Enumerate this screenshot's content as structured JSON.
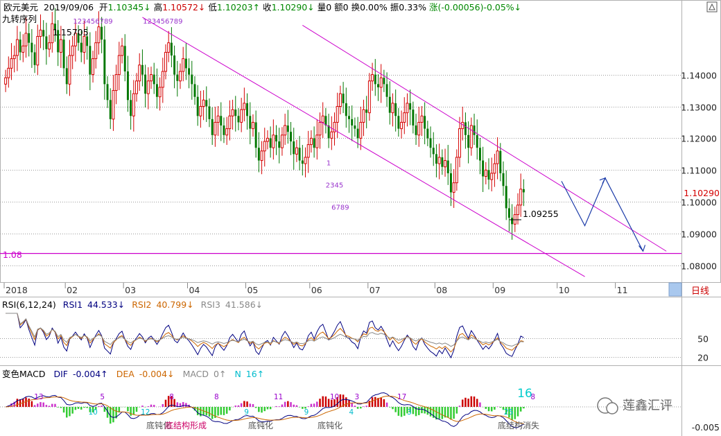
{
  "header": {
    "symbol": "欧元美元",
    "date": "2019/09/06",
    "open_label": "开",
    "open_value": "1.10345↓",
    "high_label": "高",
    "high_value": "1.10572↓",
    "low_label": "低",
    "low_value": "1.10203↑",
    "close_label": "收",
    "close_value": "1.10290↓",
    "volume": "量0",
    "amount": "额0",
    "turnover": "换0.00%",
    "amplitude": "振0.33%",
    "change": "涨(-0.00056)-0.05%↓",
    "indicator_name": "九转序列"
  },
  "colors": {
    "up": "#d40000",
    "down": "#007700",
    "channel": "#cc00cc",
    "grid": "#9a9a9a",
    "axis_text": "#222222",
    "rsi1": "#000080",
    "rsi2": "#cc6600",
    "rsi3": "#888888",
    "dif": "#000080",
    "dea": "#cc6600"
  },
  "chart_data": [
    {
      "type": "candlestick",
      "title": "欧元美元 日线",
      "ylim": [
        1.075,
        1.163
      ],
      "y_ticks": [
        1.08,
        1.09,
        1.1,
        1.11,
        1.12,
        1.13,
        1.14
      ],
      "y_tick_labels": [
        "1.08000",
        "1.09000",
        "1.10000",
        "1.11000",
        "1.12000",
        "1.13000",
        "1.14000"
      ],
      "x_month_labels": [
        "2018",
        "02",
        "03",
        "04",
        "05",
        "06",
        "07",
        "08",
        "09",
        "10",
        "11"
      ],
      "x_month_starts": [
        0,
        21,
        41,
        63,
        83,
        105,
        125,
        148,
        168,
        190,
        210
      ],
      "x_bar_count": 232,
      "period_label": "日线",
      "close_series": [
        1.139,
        1.142,
        1.145,
        1.146,
        1.151,
        1.147,
        1.149,
        1.153,
        1.15,
        1.147,
        1.143,
        1.152,
        1.154,
        1.152,
        1.148,
        1.15,
        1.156,
        1.154,
        1.147,
        1.151,
        1.142,
        1.137,
        1.146,
        1.149,
        1.153,
        1.15,
        1.147,
        1.152,
        1.149,
        1.14,
        1.145,
        1.15,
        1.155,
        1.151,
        1.137,
        1.132,
        1.126,
        1.135,
        1.14,
        1.146,
        1.149,
        1.141,
        1.132,
        1.127,
        1.134,
        1.138,
        1.143,
        1.14,
        1.134,
        1.138,
        1.14,
        1.137,
        1.133,
        1.136,
        1.141,
        1.147,
        1.15,
        1.146,
        1.14,
        1.138,
        1.141,
        1.145,
        1.142,
        1.14,
        1.137,
        1.133,
        1.127,
        1.13,
        1.132,
        1.13,
        1.126,
        1.121,
        1.125,
        1.127,
        1.124,
        1.121,
        1.123,
        1.127,
        1.129,
        1.127,
        1.125,
        1.129,
        1.131,
        1.127,
        1.123,
        1.125,
        1.117,
        1.113,
        1.116,
        1.119,
        1.12,
        1.117,
        1.121,
        1.119,
        1.117,
        1.121,
        1.124,
        1.122,
        1.119,
        1.115,
        1.117,
        1.113,
        1.112,
        1.114,
        1.118,
        1.12,
        1.117,
        1.121,
        1.125,
        1.127,
        1.124,
        1.12,
        1.122,
        1.125,
        1.13,
        1.134,
        1.131,
        1.127,
        1.126,
        1.124,
        1.123,
        1.12,
        1.125,
        1.129,
        1.128,
        1.138,
        1.14,
        1.137,
        1.136,
        1.139,
        1.137,
        1.133,
        1.128,
        1.131,
        1.127,
        1.123,
        1.125,
        1.128,
        1.131,
        1.129,
        1.124,
        1.121,
        1.125,
        1.127,
        1.123,
        1.12,
        1.117,
        1.115,
        1.112,
        1.114,
        1.111,
        1.113,
        1.109,
        1.103,
        1.106,
        1.114,
        1.123,
        1.125,
        1.121,
        1.117,
        1.124,
        1.121,
        1.117,
        1.113,
        1.108,
        1.11,
        1.107,
        1.109,
        1.112,
        1.116,
        1.109,
        1.105,
        1.098,
        1.095,
        1.093,
        1.096,
        1.099,
        1.104,
        1.103
      ],
      "annotations": [
        {
          "text": "1.15705",
          "kind": "high"
        },
        {
          "text": "1.09255",
          "kind": "low"
        },
        {
          "text": "1.08",
          "kind": "level",
          "value": 1.0838
        },
        {
          "text": "1.10290",
          "kind": "last_price",
          "value": 1.1029
        }
      ],
      "td_labels": [
        {
          "text": "123456789",
          "x_bar": 30,
          "y": 1.156
        },
        {
          "text": "123456789",
          "x_bar": 54,
          "y": 1.156
        },
        {
          "text": "1",
          "x_bar": 111,
          "y": 1.1115
        },
        {
          "text": "2345",
          "x_bar": 113,
          "y": 1.1045
        },
        {
          "text": "6789",
          "x_bar": 115,
          "y": 1.0975
        }
      ],
      "channel_lines": [
        {
          "from": [
            47,
            1.158
          ],
          "to": [
            199,
            1.0765
          ]
        },
        {
          "from": [
            102,
            1.1555
          ],
          "to": [
            227,
            1.0845
          ]
        }
      ],
      "horizontal_line": 1.0838,
      "projection": [
        [
          191,
          1.1065
        ],
        [
          199,
          1.0925
        ],
        [
          206,
          1.1075
        ],
        [
          219,
          1.0845
        ]
      ]
    },
    {
      "type": "line",
      "title": "RSI(6,12,24)",
      "ylim": [
        10,
        90
      ],
      "y_ticks": [
        20,
        50
      ],
      "series": [
        {
          "name": "RSI1",
          "value_text": "44.533↓"
        },
        {
          "name": "RSI2",
          "value_text": "40.799↓"
        },
        {
          "name": "RSI3",
          "value_text": "41.586↓"
        }
      ]
    },
    {
      "type": "bar",
      "title": "变色MACD",
      "y_tick_labels": [
        "-0.005"
      ],
      "series": [
        {
          "name": "DIF",
          "value_text": "-0.004↑"
        },
        {
          "name": "DEA",
          "value_text": "-0.004↓"
        },
        {
          "name": "MACD",
          "value_text": "0↑"
        },
        {
          "name": "N",
          "value_text": "16↑"
        }
      ],
      "counts_above": [
        {
          "text": "13",
          "x_bar": 17
        },
        {
          "text": "5",
          "x_bar": 51
        },
        {
          "text": "8",
          "x_bar": 88
        },
        {
          "text": "8",
          "x_bar": 112
        },
        {
          "text": "11",
          "x_bar": 145
        },
        {
          "text": "10",
          "x_bar": 175
        },
        {
          "text": "3",
          "x_bar": 187
        },
        {
          "text": "17",
          "x_bar": 211
        },
        {
          "text": "8",
          "x_bar": 281
        }
      ],
      "counts_below": [
        {
          "text": "10",
          "x_bar": 46
        },
        {
          "text": "12",
          "x_bar": 74
        },
        {
          "text": "9",
          "x_bar": 128
        },
        {
          "text": "9",
          "x_bar": 160
        },
        {
          "text": "4",
          "x_bar": 184
        },
        {
          "text": "3",
          "x_bar": 215
        },
        {
          "text": "25",
          "x_bar": 268
        }
      ],
      "big_count": "16",
      "notes": [
        "底钝化",
        "底结构形成",
        "底钝化",
        "底钝化",
        "底结构消失"
      ]
    }
  ],
  "watermark": {
    "text": "莲鑫汇评"
  }
}
